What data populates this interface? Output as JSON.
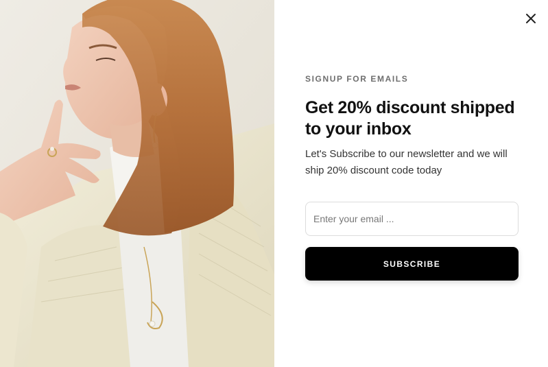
{
  "popup": {
    "eyebrow": "SIGNUP FOR EMAILS",
    "headline": "Get 20% discount shipped to your inbox",
    "description": "Let's Subscribe to our newsletter and we will ship 20% discount code today",
    "email_placeholder": "Enter your email ...",
    "email_value": "",
    "subscribe_label": "SUBSCRIBE",
    "close_icon": "close-icon"
  },
  "image": {
    "subject": "fashion-model-photo"
  },
  "colors": {
    "button_bg": "#000000",
    "button_text": "#ffffff",
    "eyebrow_text": "#6e6e6e",
    "headline_text": "#111111",
    "input_border": "#dcdcdc"
  }
}
